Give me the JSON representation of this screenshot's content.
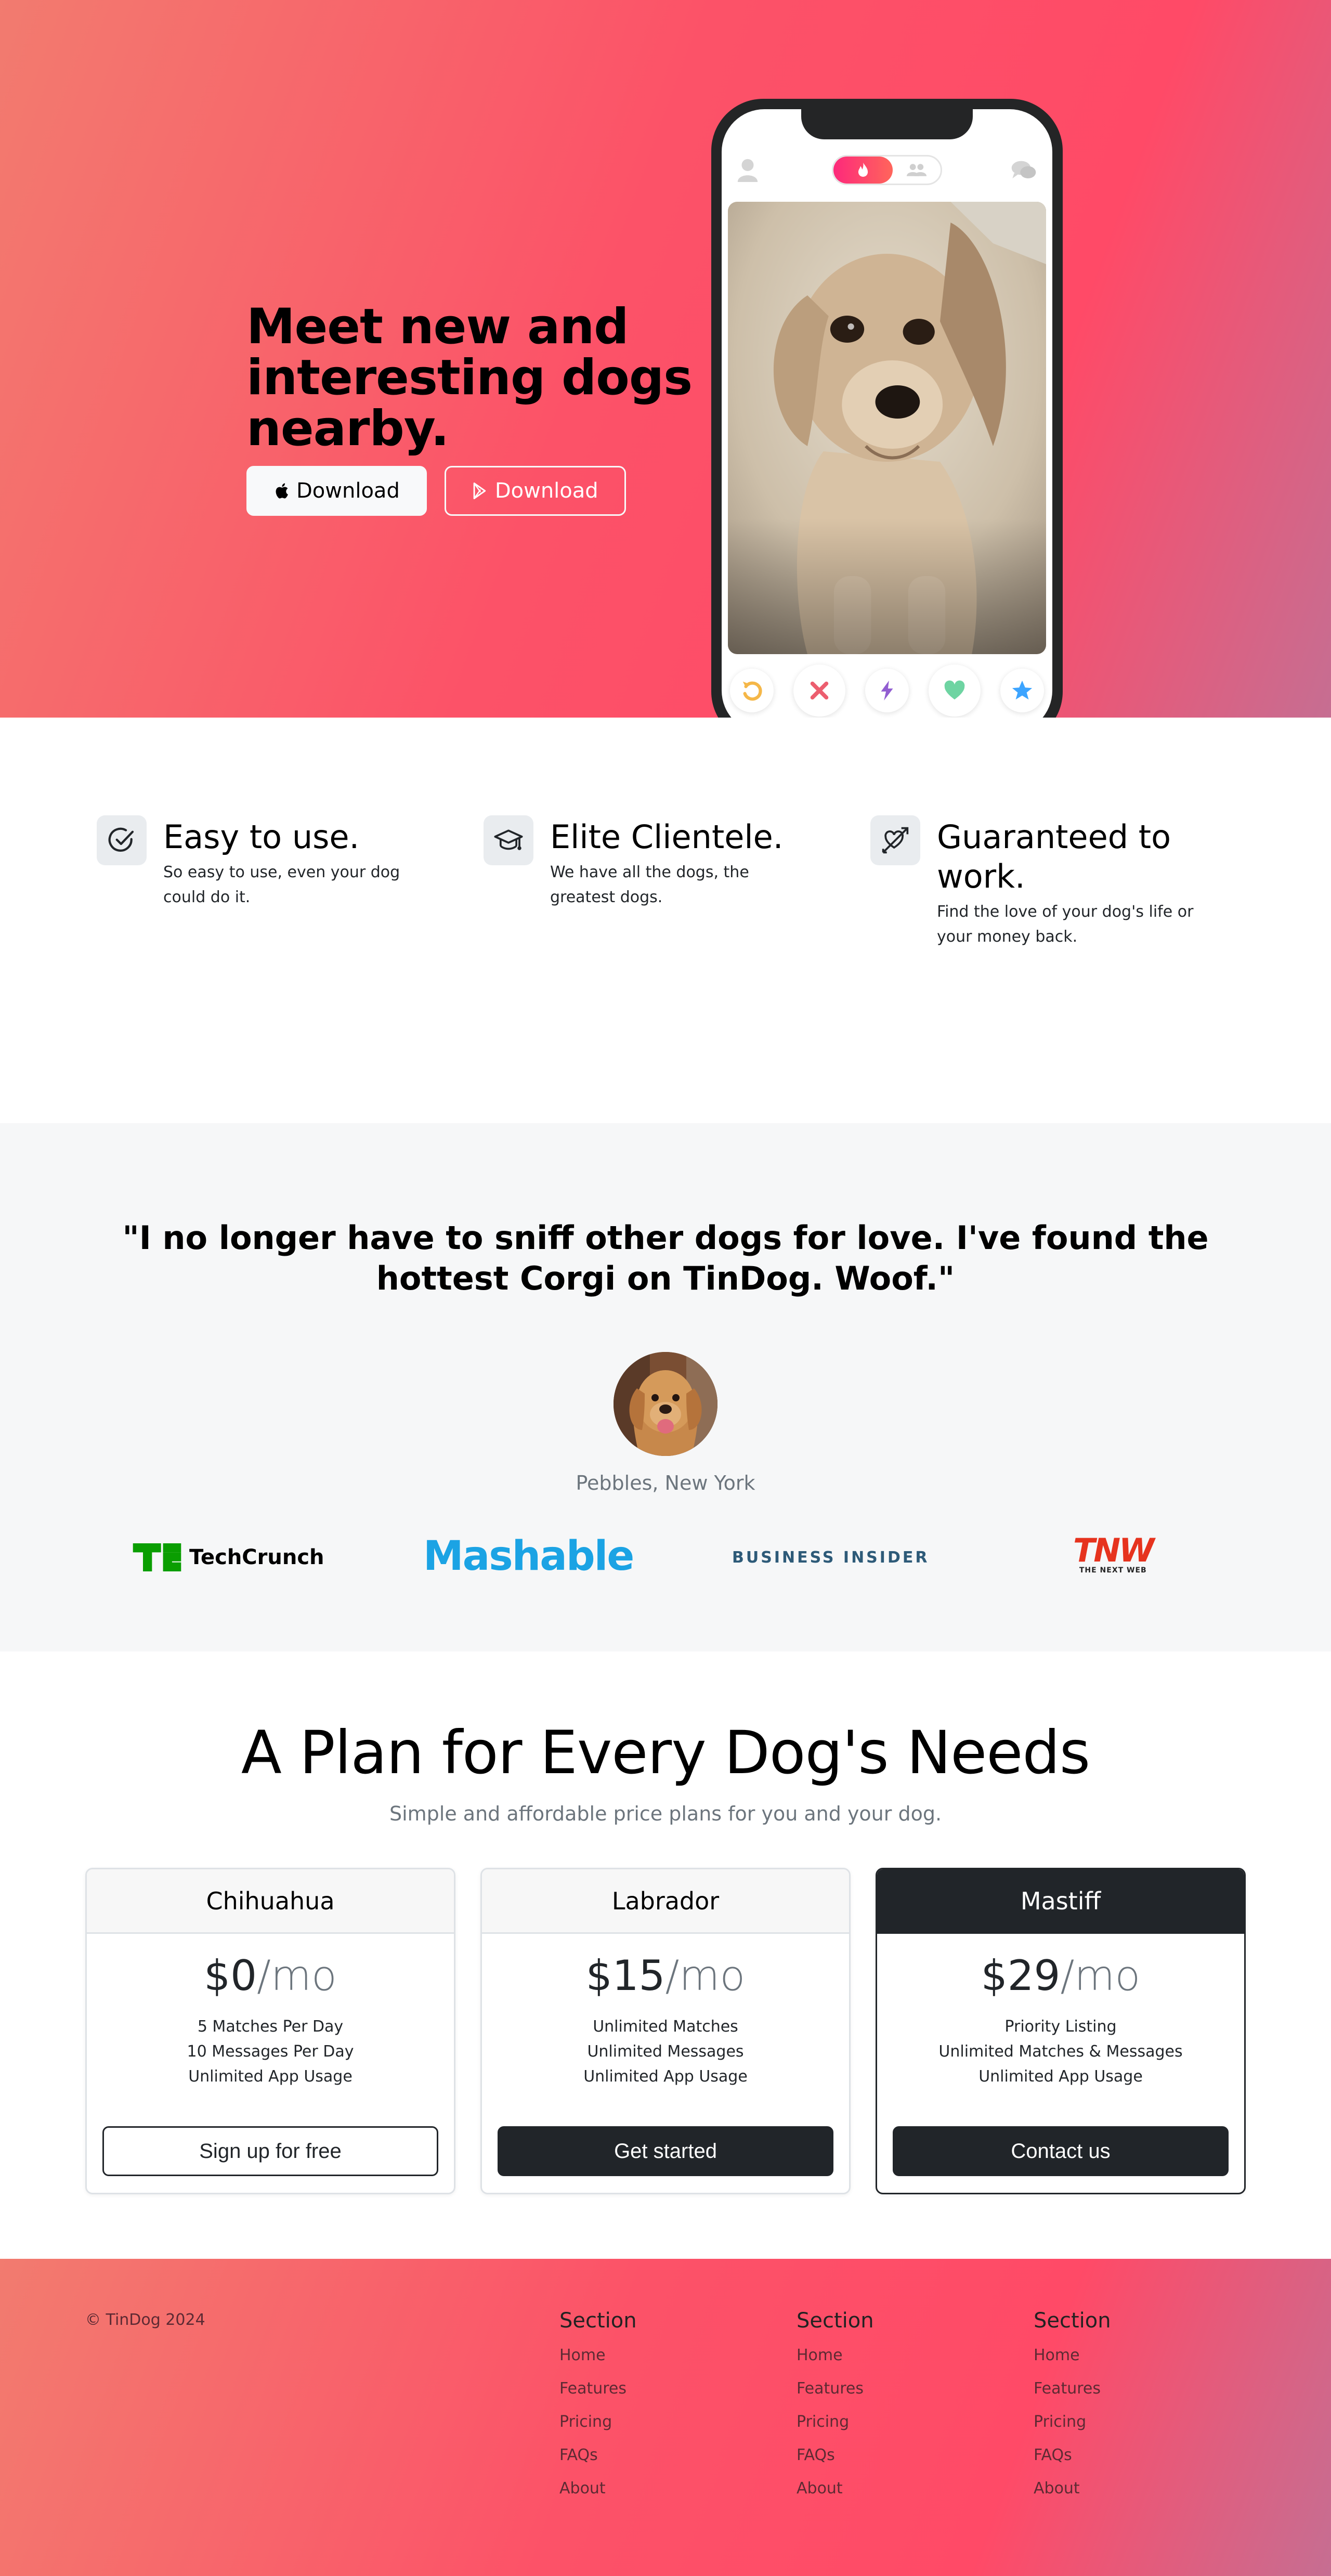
{
  "hero": {
    "title": "Meet new and interesting dogs nearby.",
    "apple_button": "Download",
    "play_button": "Download"
  },
  "phone": {
    "icons": [
      "profile-icon",
      "flame-icon",
      "group-icon",
      "chat-icon"
    ],
    "actions": [
      "rewind-icon",
      "nope-icon",
      "boost-icon",
      "like-icon",
      "super-like-icon"
    ]
  },
  "features": [
    {
      "icon": "check-circle-icon",
      "title": "Easy to use.",
      "text": "So easy to use, even your dog could do it."
    },
    {
      "icon": "graduation-cap-icon",
      "title": "Elite Clientele.",
      "text": "We have all the dogs, the greatest dogs."
    },
    {
      "icon": "heart-arrow-icon",
      "title": "Guaranteed to work.",
      "text": "Find the love of your dog's life or your money back."
    }
  ],
  "testimonial": {
    "quote": "\"I no longer have to sniff other dogs for love. I've found the hottest Corgi on TinDog. Woof.\"",
    "name": "Pebbles, New York"
  },
  "press": {
    "techcrunch": "TechCrunch",
    "mashable": "Mashable",
    "business_insider": "BUSINESS INSIDER",
    "tnw": "TNW",
    "tnw_sub": "THE NEXT WEB"
  },
  "pricing": {
    "title": "A Plan for Every Dog's Needs",
    "subtitle": "Simple and affordable price plans for you and your dog.",
    "plans": [
      {
        "name": "Chihuahua",
        "price": "$0",
        "per": "/mo",
        "features": [
          "5 Matches Per Day",
          "10 Messages Per Day",
          "Unlimited App Usage"
        ],
        "button": "Sign up for free"
      },
      {
        "name": "Labrador",
        "price": "$15",
        "per": "/mo",
        "features": [
          "Unlimited Matches",
          "Unlimited Messages",
          "Unlimited App Usage"
        ],
        "button": "Get started"
      },
      {
        "name": "Mastiff",
        "price": "$29",
        "per": "/mo",
        "features": [
          "Priority Listing",
          "Unlimited Matches & Messages",
          "Unlimited App Usage"
        ],
        "button": "Contact us"
      }
    ]
  },
  "footer": {
    "copyright": "© TinDog 2024",
    "columns": [
      {
        "heading": "Section",
        "links": [
          "Home",
          "Features",
          "Pricing",
          "FAQs",
          "About"
        ]
      },
      {
        "heading": "Section",
        "links": [
          "Home",
          "Features",
          "Pricing",
          "FAQs",
          "About"
        ]
      },
      {
        "heading": "Section",
        "links": [
          "Home",
          "Features",
          "Pricing",
          "FAQs",
          "About"
        ]
      }
    ]
  },
  "colors": {
    "brand_gradient_start": "#f27b6f",
    "brand_gradient_mid": "#ff4a67",
    "brand_gradient_end": "#c66e92",
    "dark": "#212529",
    "muted": "#6c757d"
  }
}
